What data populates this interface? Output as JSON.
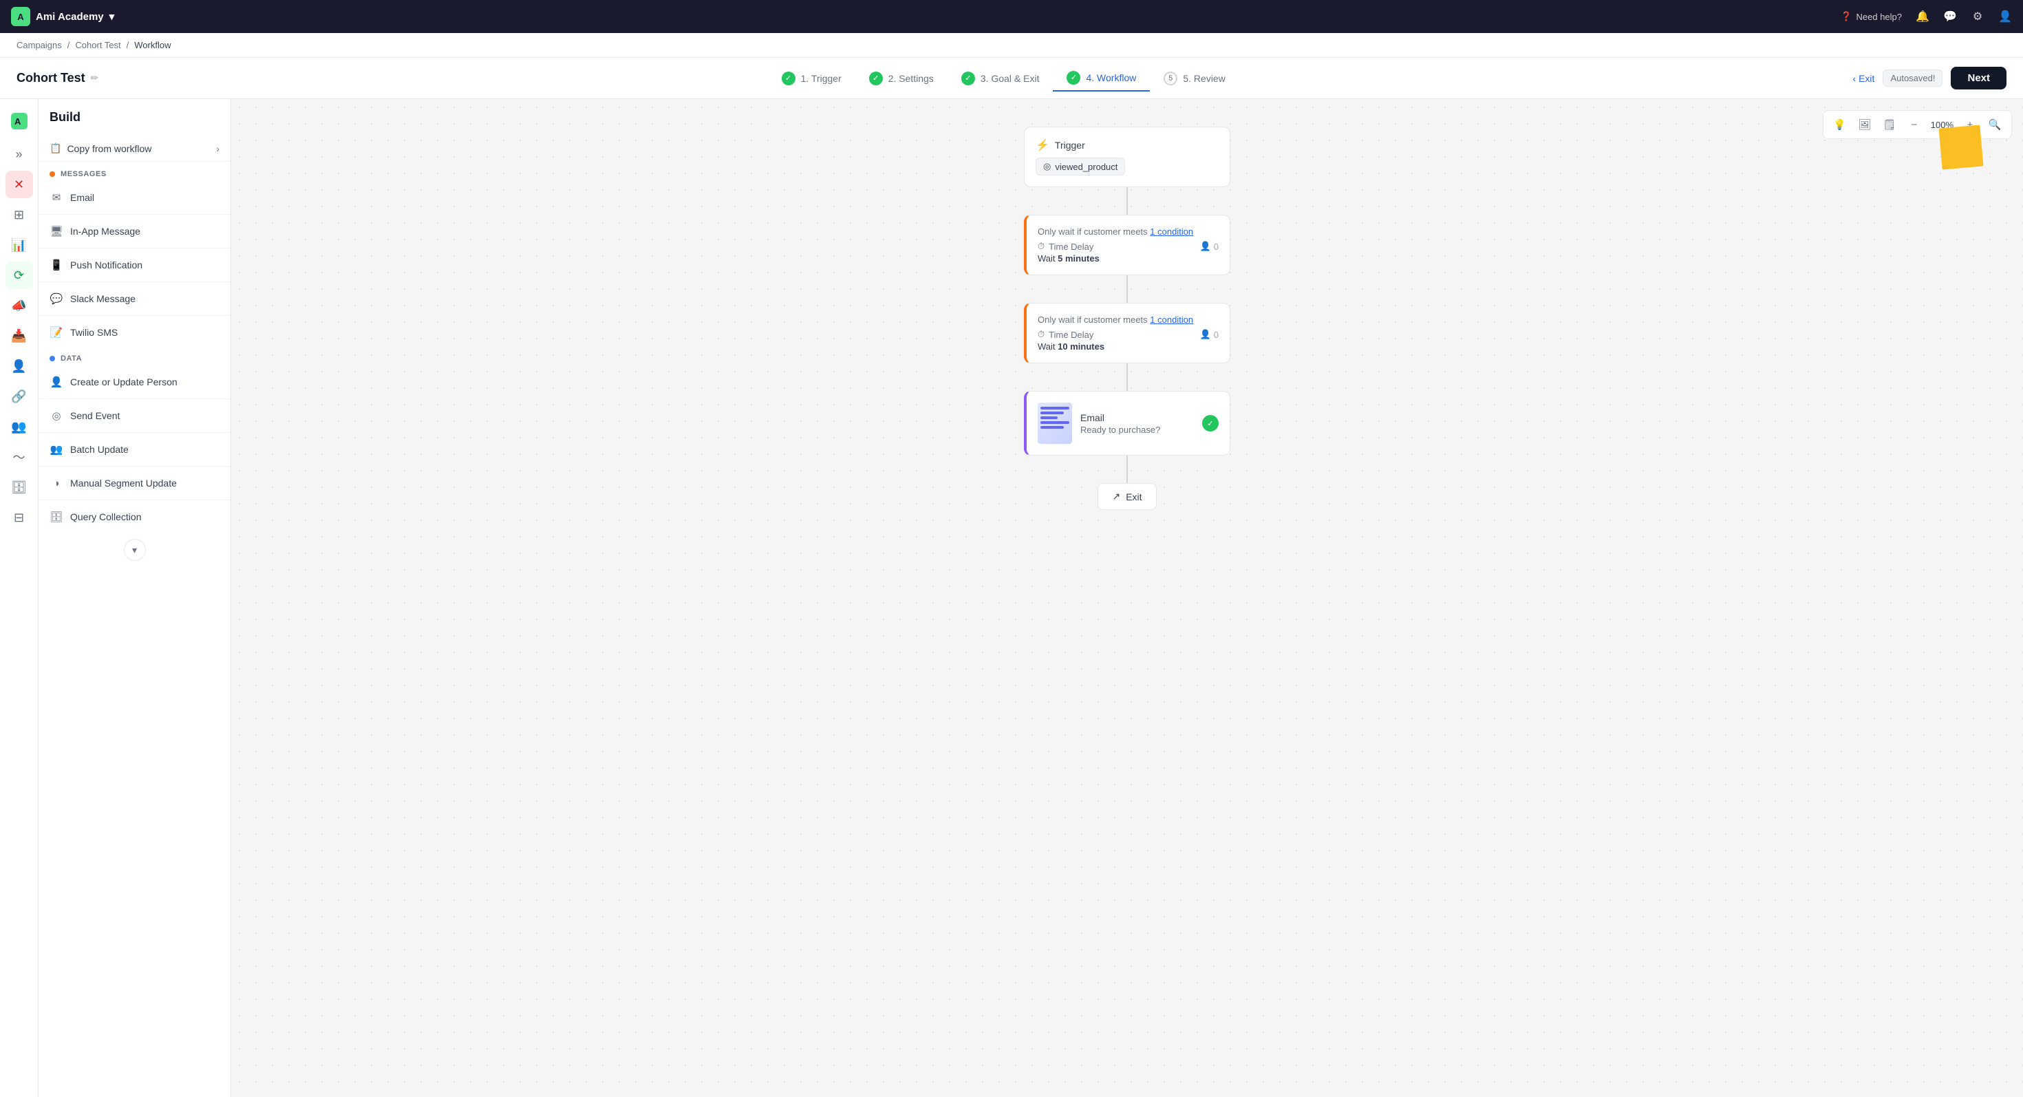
{
  "topbar": {
    "brand_name": "Ami Academy",
    "chevron": "▾",
    "need_help": "Need help?",
    "icons": {
      "bell": "🔔",
      "chat": "💬",
      "settings": "⚙",
      "profile": "👤"
    }
  },
  "breadcrumb": {
    "campaigns": "Campaigns",
    "sep1": "/",
    "cohort_test": "Cohort Test",
    "sep2": "/",
    "workflow": "Workflow"
  },
  "header": {
    "page_title": "Cohort Test",
    "edit_icon": "✏",
    "steps": [
      {
        "id": "trigger",
        "label": "1. Trigger",
        "completed": true
      },
      {
        "id": "settings",
        "label": "2. Settings",
        "completed": true
      },
      {
        "id": "goal",
        "label": "3. Goal & Exit",
        "completed": true
      },
      {
        "id": "workflow",
        "label": "4. Workflow",
        "completed": false,
        "active": true
      },
      {
        "id": "review",
        "label": "5. Review",
        "completed": false
      }
    ],
    "exit_btn": "Exit",
    "autosaved": "Autosaved!",
    "next_btn": "Next"
  },
  "icon_sidebar": {
    "items": [
      {
        "id": "logo",
        "icon": "◆",
        "active": false,
        "special": false
      },
      {
        "id": "expand",
        "icon": "»",
        "active": false
      },
      {
        "id": "x",
        "icon": "✕",
        "active": false,
        "special": true
      },
      {
        "id": "dashboard",
        "icon": "⊞",
        "active": false
      },
      {
        "id": "chart",
        "icon": "📊",
        "active": false
      },
      {
        "id": "automation",
        "icon": "⟳",
        "active": true
      },
      {
        "id": "megaphone",
        "icon": "📣",
        "active": false
      },
      {
        "id": "inbox",
        "icon": "📥",
        "active": false
      },
      {
        "id": "person",
        "icon": "👤",
        "active": false
      },
      {
        "id": "integrations",
        "icon": "🔗",
        "active": false
      },
      {
        "id": "audience",
        "icon": "👥",
        "active": false
      },
      {
        "id": "pulse",
        "icon": "〜",
        "active": false
      },
      {
        "id": "database",
        "icon": "🗄",
        "active": false
      },
      {
        "id": "table",
        "icon": "⊟",
        "active": false
      }
    ]
  },
  "build_panel": {
    "title": "Build",
    "copy_workflow": "Copy from workflow",
    "copy_arrow": "→",
    "messages_label": "MESSAGES",
    "data_label": "DATA",
    "message_items": [
      {
        "id": "email",
        "icon": "✉",
        "label": "Email"
      },
      {
        "id": "in-app",
        "icon": "🖥",
        "label": "In-App Message"
      },
      {
        "id": "push",
        "icon": "📱",
        "label": "Push Notification"
      },
      {
        "id": "slack",
        "icon": "💬",
        "label": "Slack Message"
      },
      {
        "id": "twilio",
        "icon": "📝",
        "label": "Twilio SMS"
      }
    ],
    "data_items": [
      {
        "id": "create-person",
        "icon": "👤",
        "label": "Create or Update Person"
      },
      {
        "id": "send-event",
        "icon": "◎",
        "label": "Send Event"
      },
      {
        "id": "batch-update",
        "icon": "👥",
        "label": "Batch Update"
      },
      {
        "id": "manual-segment",
        "icon": "◑",
        "label": "Manual Segment Update"
      },
      {
        "id": "query-collection",
        "icon": "🗄",
        "label": "Query Collection"
      }
    ],
    "expand_icon": "▾"
  },
  "canvas": {
    "toolbar": {
      "lightbulb": "💡",
      "image": "🖼",
      "note": "🗒",
      "zoom_out": "−",
      "zoom_level": "100%",
      "zoom_in": "+",
      "search": "🔍"
    },
    "nodes": {
      "trigger": {
        "label": "Trigger",
        "event": "viewed_product",
        "event_icon": "◎"
      },
      "delay1": {
        "condition": "Only wait if customer meets",
        "condition_link": "1 condition",
        "type": "Time Delay",
        "count": "0",
        "wait_prefix": "Wait",
        "wait_value": "5 minutes"
      },
      "delay2": {
        "condition": "Only wait if customer meets",
        "condition_link": "1 condition",
        "type": "Time Delay",
        "count": "0",
        "wait_prefix": "Wait",
        "wait_value": "10 minutes"
      },
      "email": {
        "title": "Email",
        "subtitle": "Ready to purchase?"
      },
      "exit": {
        "label": "Exit"
      }
    }
  }
}
